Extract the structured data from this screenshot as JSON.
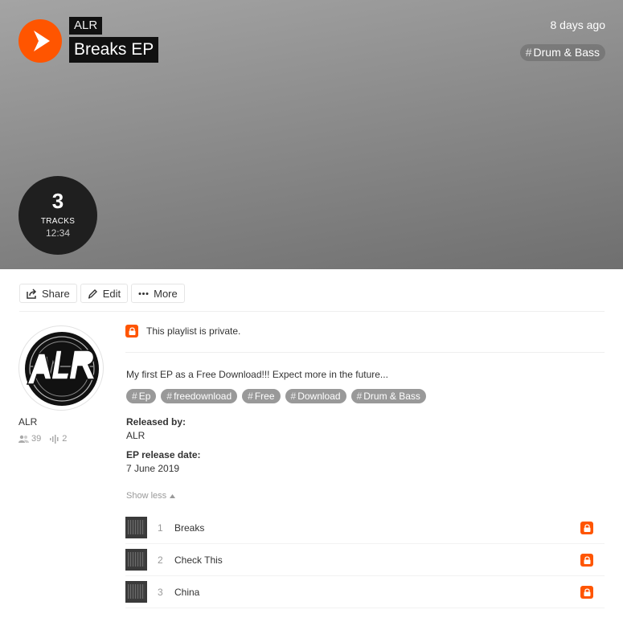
{
  "header": {
    "username": "ALR",
    "title": "Breaks EP",
    "posted": "8 days ago",
    "genre_tag": "Drum & Bass",
    "track_count": "3",
    "track_count_label": "TRACKS",
    "duration": "12:34"
  },
  "actions": {
    "share_label": "Share",
    "edit_label": "Edit",
    "more_label": "More"
  },
  "user": {
    "name": "ALR",
    "followers": "39",
    "tracks": "2"
  },
  "playlist": {
    "private_notice": "This playlist is private.",
    "description": "My first EP as a Free Download!!! Expect more in the future...",
    "tags": [
      "Ep",
      "freedownload",
      "Free",
      "Download",
      "Drum & Bass"
    ],
    "released_by_label": "Released by:",
    "released_by": "ALR",
    "release_date_label": "EP release date:",
    "release_date": "7 June 2019",
    "show_less": "Show less"
  },
  "tracks": [
    {
      "num": "1",
      "title": "Breaks"
    },
    {
      "num": "2",
      "title": "Check This"
    },
    {
      "num": "3",
      "title": "China"
    }
  ],
  "colors": {
    "accent": "#ff5500",
    "tag_bg": "#999999",
    "hero_dark": "#6f6f6f",
    "hero_light": "#a4a4a4"
  },
  "icons": [
    "play-icon",
    "share-icon",
    "pencil-icon",
    "more-dots-icon",
    "followers-icon",
    "waveform-icon",
    "lock-icon",
    "caret-up-icon"
  ]
}
